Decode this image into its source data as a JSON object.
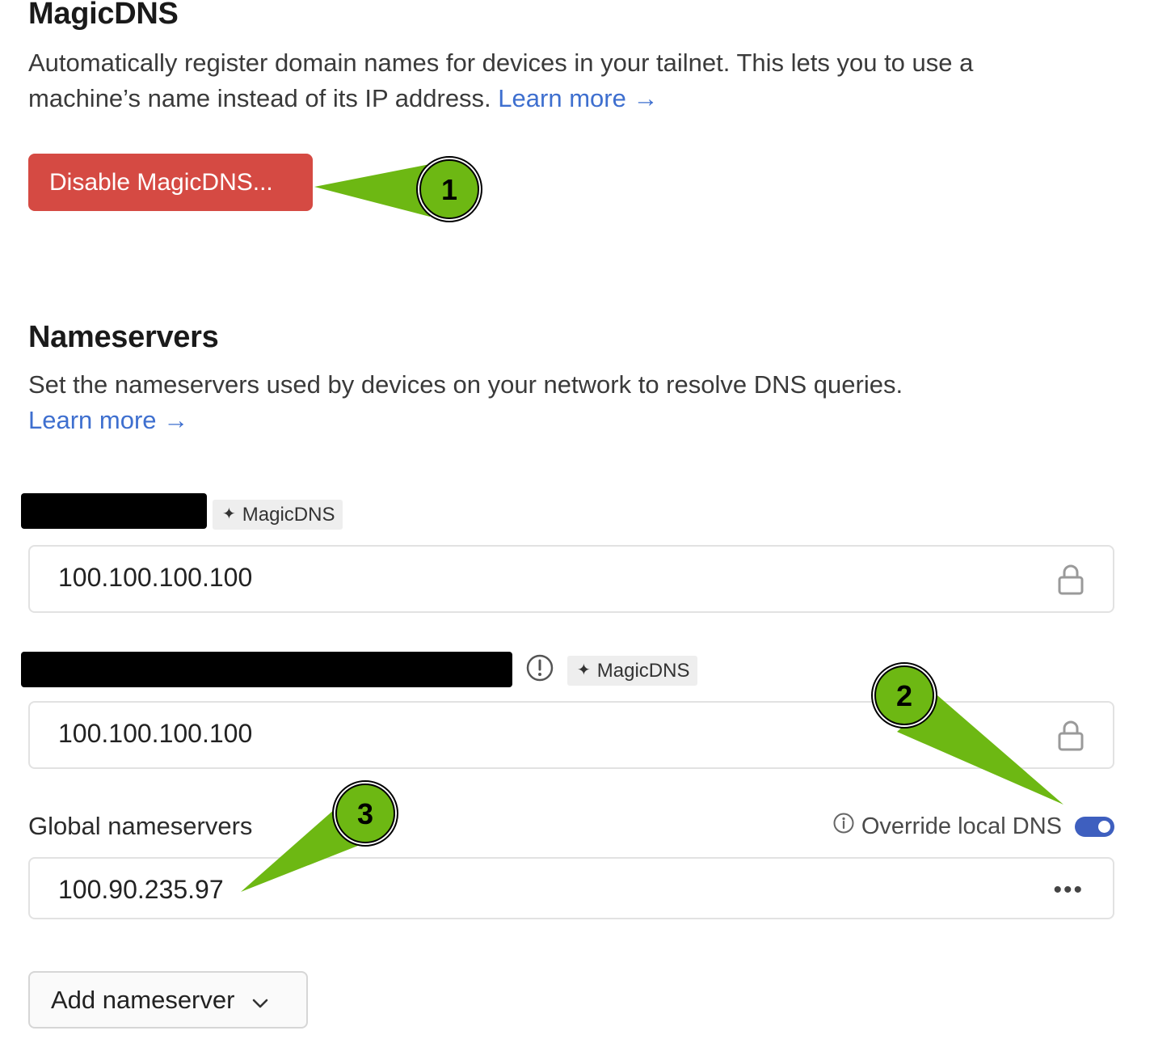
{
  "magicdns": {
    "title": "MagicDNS",
    "description_line1": "Automatically register domain names for devices in your tailnet. This lets you to use a",
    "description_line2": "machine’s name instead of its IP address.",
    "learn_more": "Learn more →",
    "disable_button": "Disable MagicDNS..."
  },
  "nameservers": {
    "title": "Nameservers",
    "description": "Set the nameservers used by devices on your network to resolve DNS queries.",
    "learn_more": "Learn more →",
    "entries": [
      {
        "badge": "MagicDNS",
        "value": "100.100.100.100"
      },
      {
        "badge": "MagicDNS",
        "value": "100.100.100.100"
      }
    ],
    "global": {
      "label": "Global nameservers",
      "override_label": "Override local DNS",
      "override_enabled": true,
      "value": "100.90.235.97"
    },
    "add_button": "Add nameserver"
  },
  "callouts": [
    "1",
    "2",
    "3"
  ],
  "colors": {
    "danger": "#d54a43",
    "link": "#3e6fcf",
    "toggle_on": "#3e5fbf",
    "callout_green": "#6db813"
  }
}
